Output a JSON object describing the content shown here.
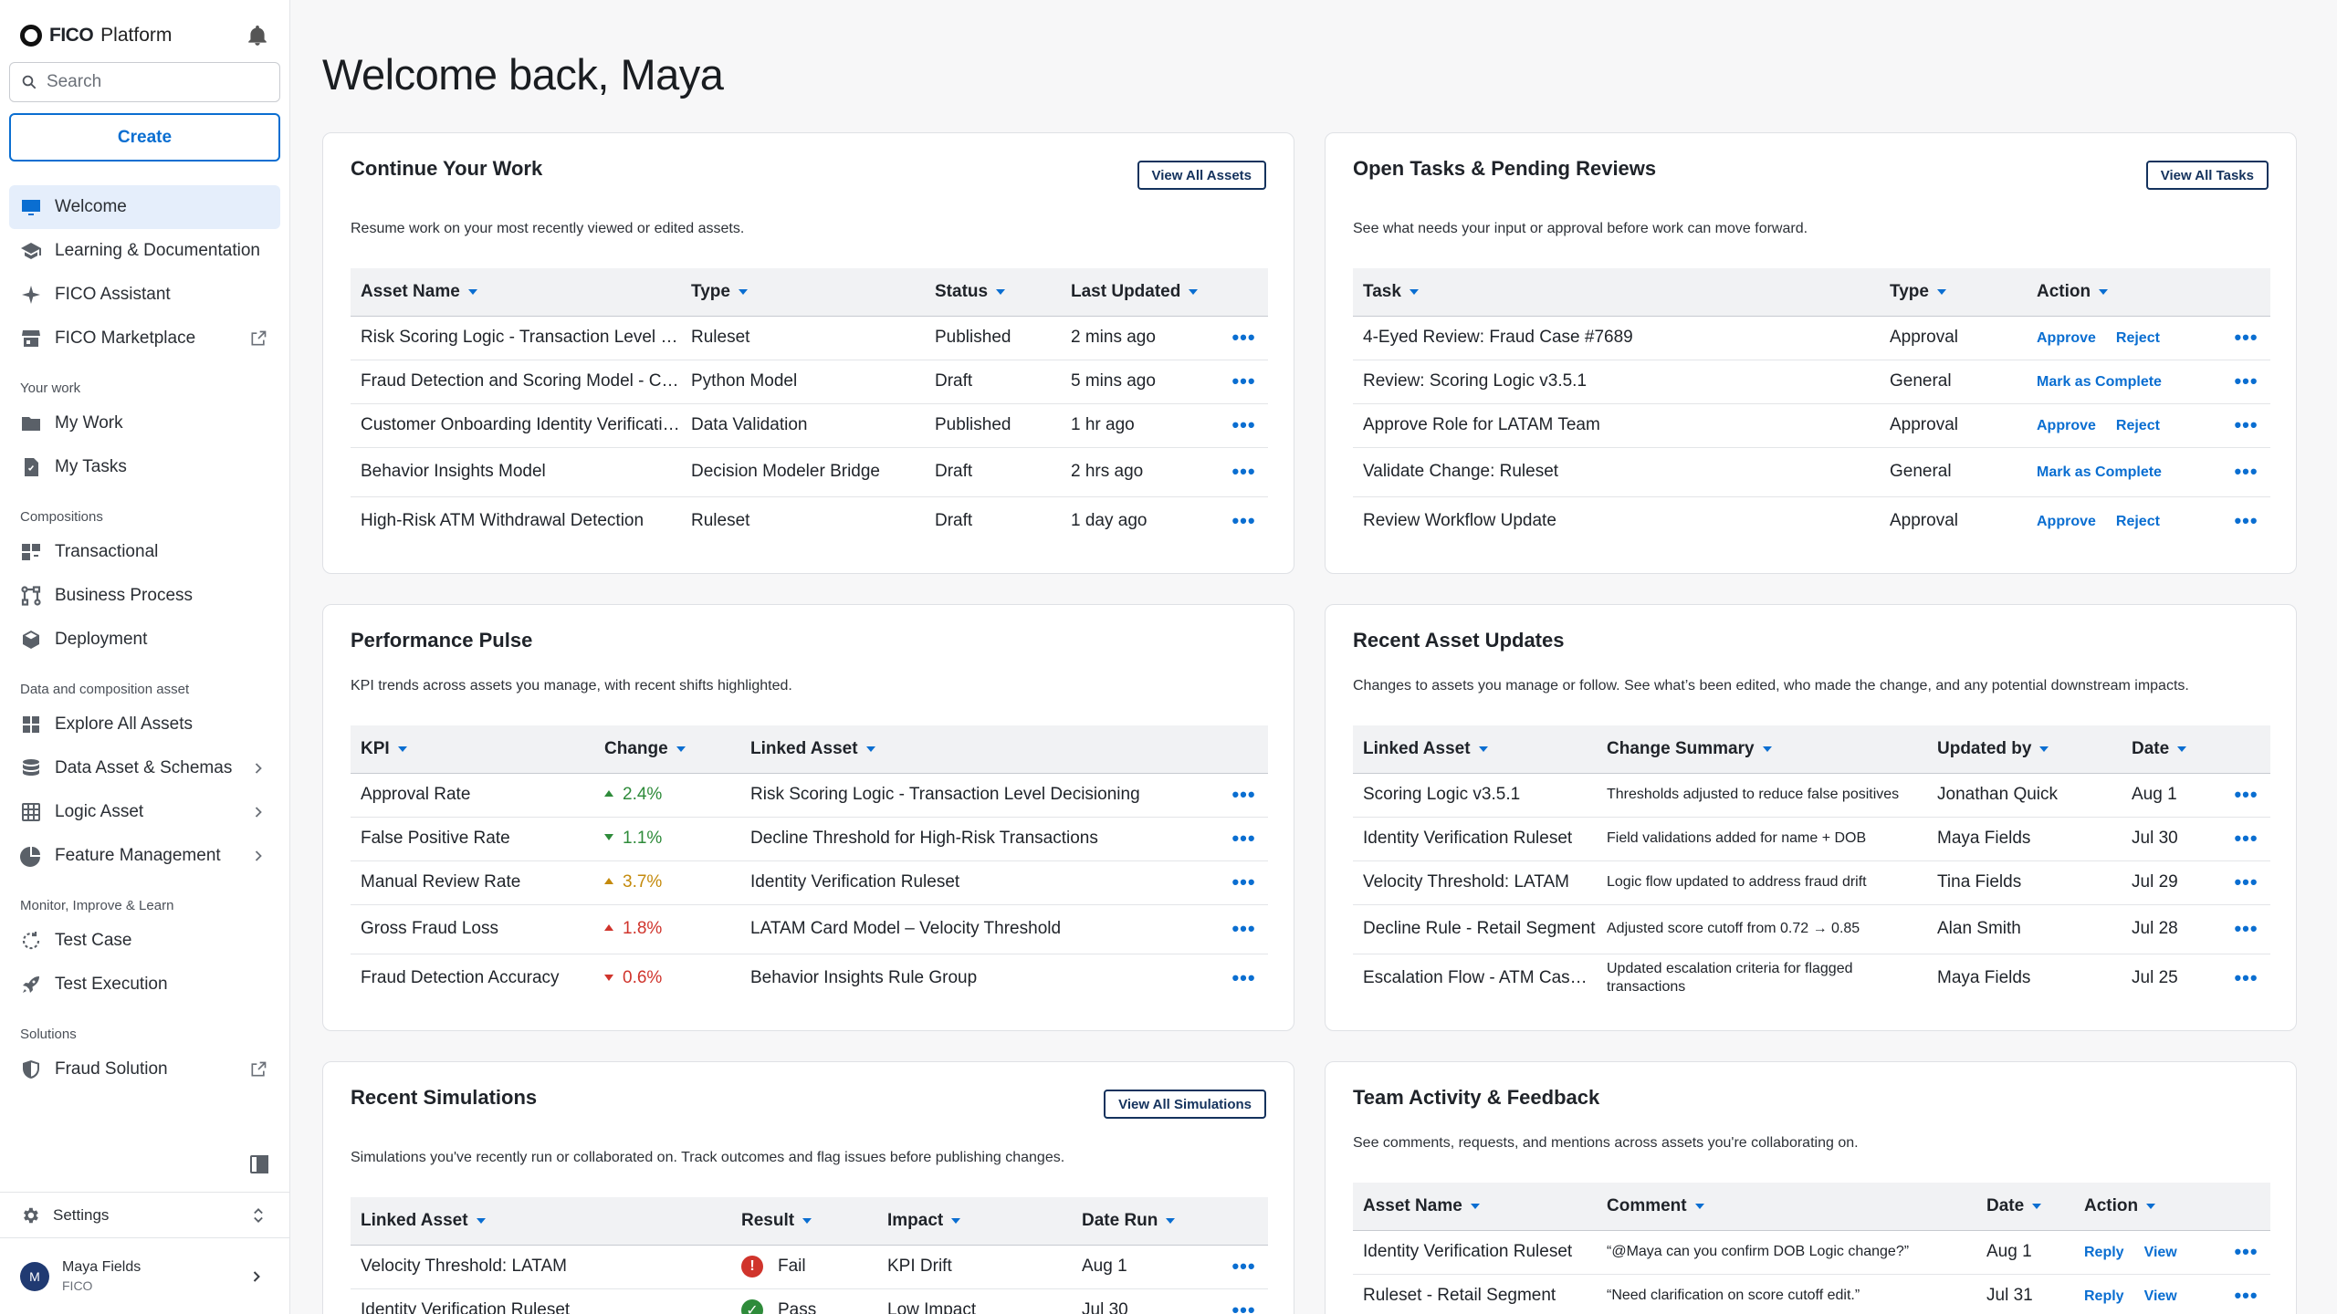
{
  "brand": {
    "name_bold": "FICO",
    "name_rest": "Platform"
  },
  "search": {
    "placeholder": "Search"
  },
  "create_label": "Create",
  "nav": {
    "welcome": "Welcome",
    "learning": "Learning & Documentation",
    "assistant": "FICO Assistant",
    "marketplace": "FICO Marketplace",
    "groups": {
      "your_work": "Your work",
      "compositions": "Compositions",
      "data": "Data and composition asset",
      "monitor": "Monitor, Improve & Learn",
      "solutions": "Solutions"
    },
    "my_work": "My Work",
    "my_tasks": "My Tasks",
    "transactional": "Transactional",
    "business_process": "Business Process",
    "deployment": "Deployment",
    "explore_assets": "Explore All Assets",
    "data_schemas": "Data Asset & Schemas",
    "logic_asset": "Logic Asset",
    "feature_mgmt": "Feature Management",
    "test_case": "Test Case",
    "test_execution": "Test Execution",
    "fraud_solution": "Fraud Solution",
    "settings": "Settings"
  },
  "user": {
    "initial": "M",
    "name": "Maya Fields",
    "org": "FICO"
  },
  "page_title": "Welcome back, Maya",
  "continue_work": {
    "title": "Continue Your Work",
    "button": "View All Assets",
    "subtitle": "Resume work on your most recently viewed or edited assets.",
    "headers": [
      "Asset Name",
      "Type",
      "Status",
      "Last Updated"
    ],
    "rows": [
      [
        "Risk Scoring Logic - Transaction Level Decisioning",
        "Ruleset",
        "Published",
        "2 mins ago"
      ],
      [
        "Fraud Detection and Scoring Model - Cards",
        "Python Model",
        "Draft",
        "5 mins ago"
      ],
      [
        "Customer Onboarding Identity Verification",
        "Data Validation",
        "Published",
        "1 hr ago"
      ],
      [
        "Behavior Insights Model",
        "Decision Modeler Bridge",
        "Draft",
        "2 hrs ago"
      ],
      [
        "High-Risk ATM Withdrawal Detection",
        "Ruleset",
        "Draft",
        "1 day ago"
      ]
    ]
  },
  "open_tasks": {
    "title": "Open Tasks & Pending Reviews",
    "button": "View All Tasks",
    "subtitle": "See what needs your input or approval before work can move forward.",
    "headers": [
      "Task",
      "Type",
      "Action"
    ],
    "approve": "Approve",
    "reject": "Reject",
    "mark_complete": "Mark as Complete",
    "rows": [
      [
        "4-Eyed Review: Fraud Case #7689",
        "Approval"
      ],
      [
        "Review: Scoring Logic v3.5.1",
        "General"
      ],
      [
        "Approve Role for LATAM Team",
        "Approval"
      ],
      [
        "Validate Change: Ruleset",
        "General"
      ],
      [
        "Review Workflow Update",
        "Approval"
      ]
    ]
  },
  "performance": {
    "title": "Performance Pulse",
    "subtitle": "KPI trends across assets you manage, with recent shifts highlighted.",
    "headers": [
      "KPI",
      "Change",
      "Linked Asset"
    ],
    "rows": [
      [
        "Approval Rate",
        "2.4%",
        "Risk Scoring Logic - Transaction Level Decisioning"
      ],
      [
        "False Positive Rate",
        "1.1%",
        "Decline Threshold for High-Risk Transactions"
      ],
      [
        "Manual Review Rate",
        "3.7%",
        "Identity Verification Ruleset"
      ],
      [
        "Gross Fraud Loss",
        "1.8%",
        "LATAM Card Model – Velocity Threshold"
      ],
      [
        "Fraud Detection Accuracy",
        "0.6%",
        "Behavior Insights Rule Group"
      ]
    ]
  },
  "recent_updates": {
    "title": "Recent Asset Updates",
    "subtitle": "Changes to assets you manage or follow. See what’s been edited, who made the change, and any potential downstream impacts.",
    "headers": [
      "Linked Asset",
      "Change Summary",
      "Updated by",
      "Date"
    ],
    "rows": [
      [
        "Scoring Logic v3.5.1",
        "Thresholds adjusted to reduce false positives",
        "Jonathan Quick",
        "Aug 1"
      ],
      [
        "Identity Verification Ruleset",
        "Field validations added for name + DOB",
        "Maya Fields",
        "Jul 30"
      ],
      [
        "Velocity Threshold: LATAM",
        "Logic flow updated to address fraud drift",
        "Tina Fields",
        "Jul 29"
      ],
      [
        "Decline Rule - Retail Segment",
        "Adjusted score cutoff from 0.72 → 0.85",
        "Alan Smith",
        "Jul 28"
      ],
      [
        "Escalation Flow - ATM Cash Withdrawals",
        "Updated escalation criteria for flagged transactions",
        "Maya Fields",
        "Jul 25"
      ]
    ]
  },
  "simulations": {
    "title": "Recent Simulations",
    "button": "View All Simulations",
    "subtitle": "Simulations you've recently run or collaborated on. Track outcomes and flag issues before publishing changes.",
    "headers": [
      "Linked Asset",
      "Result",
      "Impact",
      "Date Run"
    ],
    "rows": [
      [
        "Velocity Threshold: LATAM",
        "Fail",
        "KPI Drift",
        "Aug 1"
      ],
      [
        "Identity Verification Ruleset",
        "Pass",
        "Low Impact",
        "Jul 30"
      ]
    ]
  },
  "team_activity": {
    "title": "Team Activity & Feedback",
    "subtitle": "See comments, requests, and mentions across assets you're collaborating on.",
    "headers": [
      "Asset Name",
      "Comment",
      "Date",
      "Action"
    ],
    "reply": "Reply",
    "view": "View",
    "rows": [
      [
        "Identity Verification Ruleset",
        "“@Maya can you confirm DOB Logic change?”",
        "Aug 1"
      ],
      [
        "Ruleset - Retail Segment",
        "“Need clarification on score cutoff edit.”",
        "Jul 31"
      ]
    ]
  },
  "more_glyph": "•••",
  "colors": {
    "accent": "#0a6ed1",
    "active_bg": "#e5eefb",
    "up_green": "#2e8b3a",
    "amber": "#c48a0c",
    "down_red": "#d0342c"
  }
}
